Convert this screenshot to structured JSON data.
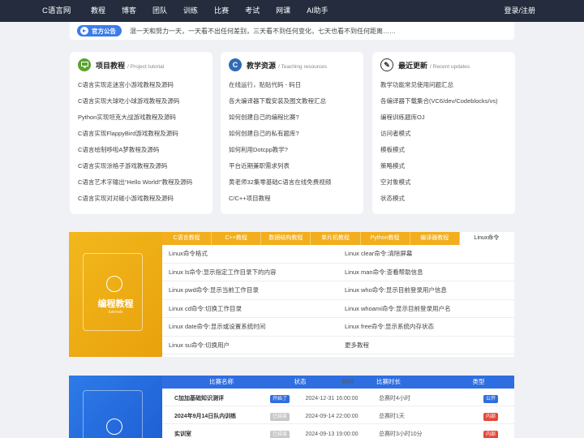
{
  "nav": {
    "logo": "C语言网",
    "items": [
      "教程",
      "博客",
      "团队",
      "训练",
      "比赛",
      "考试",
      "网课",
      "AI助手"
    ],
    "login": "登录/注册"
  },
  "notice": {
    "badge": "官方公告",
    "text": "混一天和努力一天，一天看不出任何差别，三天看不到任何变化，七天也看不到任何距离……"
  },
  "cards": [
    {
      "title": "项目教程",
      "subtitle": "/ Project tutorial",
      "icon": "monitor-icon",
      "color": "#5aa32f",
      "items": [
        "C语言实现走迷宫小游戏教程及源码",
        "C语言实现大球吃小球游戏教程及源码",
        "Python实现坦克大战游戏教程及源码",
        "C语言实现FlappyBird游戏教程及源码",
        "C语言绘制哆啦A梦教程及源码",
        "C语言实现涂格子游戏教程及源码",
        "C语言艺术字输出“Hello World!”教程及源码",
        "C语言实现对对碰小游戏教程及源码"
      ]
    },
    {
      "title": "教学资源",
      "subtitle": "/ Teaching resources",
      "icon": "c-logo-icon",
      "color": "#2f6ab6",
      "items": [
        "在线运行，贴贴代码 - 码日",
        "各大编译器下载安装及图文教程汇总",
        "如何创建自己的编程比赛?",
        "如何创建自己的私有题库?",
        "如何利用Dotcpp教学?",
        "平台近期兼职需求列表",
        "黄老师32集零基础C语言在线免费视频",
        "C/C++项目教程"
      ]
    },
    {
      "title": "最近更新",
      "subtitle": "/ Recent updates",
      "icon": "edit-icon",
      "color": "#333333",
      "items": [
        "教学功能常见使用问题汇总",
        "各编译器下载集合(VC6/dev/Codeblocks/vs)",
        "编程训练题库OJ",
        "访问者模式",
        "模板模式",
        "策略模式",
        "空对象模式",
        "状态模式"
      ]
    }
  ],
  "tutorials": {
    "banner_title": "编程教程",
    "banner_sub": "tutorials",
    "tabs": [
      "C语言教程",
      "C++教程",
      "数据结构教程",
      "单片机教程",
      "Python教程",
      "编译器教程",
      "Linux命令"
    ],
    "rows": [
      [
        "Linux命令格式",
        "Linux clear命令:清除屏幕"
      ],
      [
        "Linux ls命令:显示指定工作目录下的内容",
        "Linux man命令:查看帮助信息"
      ],
      [
        "Linux pwd命令:显示当前工作目录",
        "Linux who命令:显示目前登录用户信息"
      ],
      [
        "Linux cd命令:切换工作目录",
        "Linux whoami命令:显示目前登录用户名"
      ],
      [
        "Linux date命令:显示或设置系统时间",
        "Linux free命令:显示系统内存状态"
      ],
      [
        "Linux su命令:切换用户",
        "更多教程"
      ]
    ]
  },
  "contests": {
    "headers": [
      "比赛名称",
      "状态",
      "时间",
      "比赛时长",
      "类型"
    ],
    "rows": [
      {
        "name": "C加加基础知识测评",
        "status": "开始了",
        "time": "2024-12-31 16:00:00",
        "duration": "总赛时4小时",
        "type": "公开",
        "scolor": "#2f6ee0",
        "tcolor": "#2f6ee0"
      },
      {
        "name": "2024年9月14日队内训练",
        "status": "已结束",
        "time": "2024-09-14 22:00:00",
        "duration": "总赛时1天",
        "type": "内部",
        "scolor": "#c8c8c8",
        "tcolor": "#e6473a"
      },
      {
        "name": "实训室",
        "status": "已结束",
        "time": "2024-09-13 19:00:00",
        "duration": "总赛时3小时10分",
        "type": "内部",
        "scolor": "#c8c8c8",
        "tcolor": "#e6473a"
      }
    ]
  }
}
